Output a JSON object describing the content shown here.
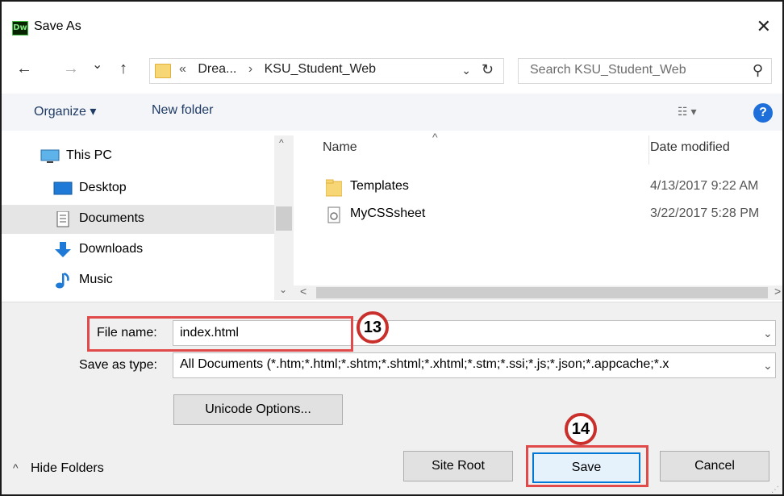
{
  "window": {
    "app_icon_text": "Dw",
    "title": "Save As",
    "close_glyph": "✕"
  },
  "nav": {
    "back_glyph": "←",
    "forward_glyph": "→",
    "recent_glyph": "⌄",
    "up_glyph": "↑",
    "address_crumbs": [
      "«",
      "Drea...",
      "›",
      "KSU_Student_Web"
    ],
    "address_dropdown_glyph": "⌄",
    "refresh_glyph": "↻",
    "search_placeholder": "Search KSU_Student_Web",
    "search_glyph": "⚲"
  },
  "commands": {
    "organize_label": "Organize ▾",
    "new_folder_label": "New folder",
    "view_glyph": "☷ ▾",
    "help_glyph": "?"
  },
  "nav_pane": {
    "items": [
      {
        "label": "This PC",
        "icon": "computer-icon",
        "selected": false
      },
      {
        "label": "Desktop",
        "icon": "desktop-icon",
        "selected": false
      },
      {
        "label": "Documents",
        "icon": "documents-icon",
        "selected": true
      },
      {
        "label": "Downloads",
        "icon": "downloads-icon",
        "selected": false
      },
      {
        "label": "Music",
        "icon": "music-icon",
        "selected": false
      }
    ],
    "scroll_up_glyph": "^",
    "scroll_down_glyph": "⌄"
  },
  "file_list": {
    "columns": [
      "Name",
      "Date modified"
    ],
    "sort_glyph": "^",
    "rows": [
      {
        "name": "Templates",
        "date": "4/13/2017 9:22 AM",
        "icon": "folder-icon"
      },
      {
        "name": "MyCSSsheet",
        "date": "3/22/2017 5:28 PM",
        "icon": "css-file-icon"
      }
    ],
    "hscroll_left_glyph": "<",
    "hscroll_right_glyph": ">"
  },
  "form": {
    "filename_label": "File name:",
    "filename_value": "index.html",
    "savetype_label": "Save as type:",
    "savetype_value": "All Documents (*.htm;*.html;*.shtm;*.shtml;*.xhtml;*.stm;*.ssi;*.js;*.json;*.appcache;*.x",
    "chevron_glyph": "⌄",
    "unicode_options_label": "Unicode Options..."
  },
  "footer": {
    "hide_folders_label": "Hide Folders",
    "hide_folders_glyph": "^",
    "site_root_label": "Site Root",
    "save_label": "Save",
    "cancel_label": "Cancel",
    "grip_glyph": "⋰"
  },
  "annotations": {
    "step_13": "13",
    "step_14": "14",
    "highlight_color": "#e04a4a"
  },
  "colors": {
    "accent": "#0078d7",
    "help_blue": "#1e6fd9",
    "folder_yellow": "#f7d675",
    "callout_red": "#c9302c"
  }
}
